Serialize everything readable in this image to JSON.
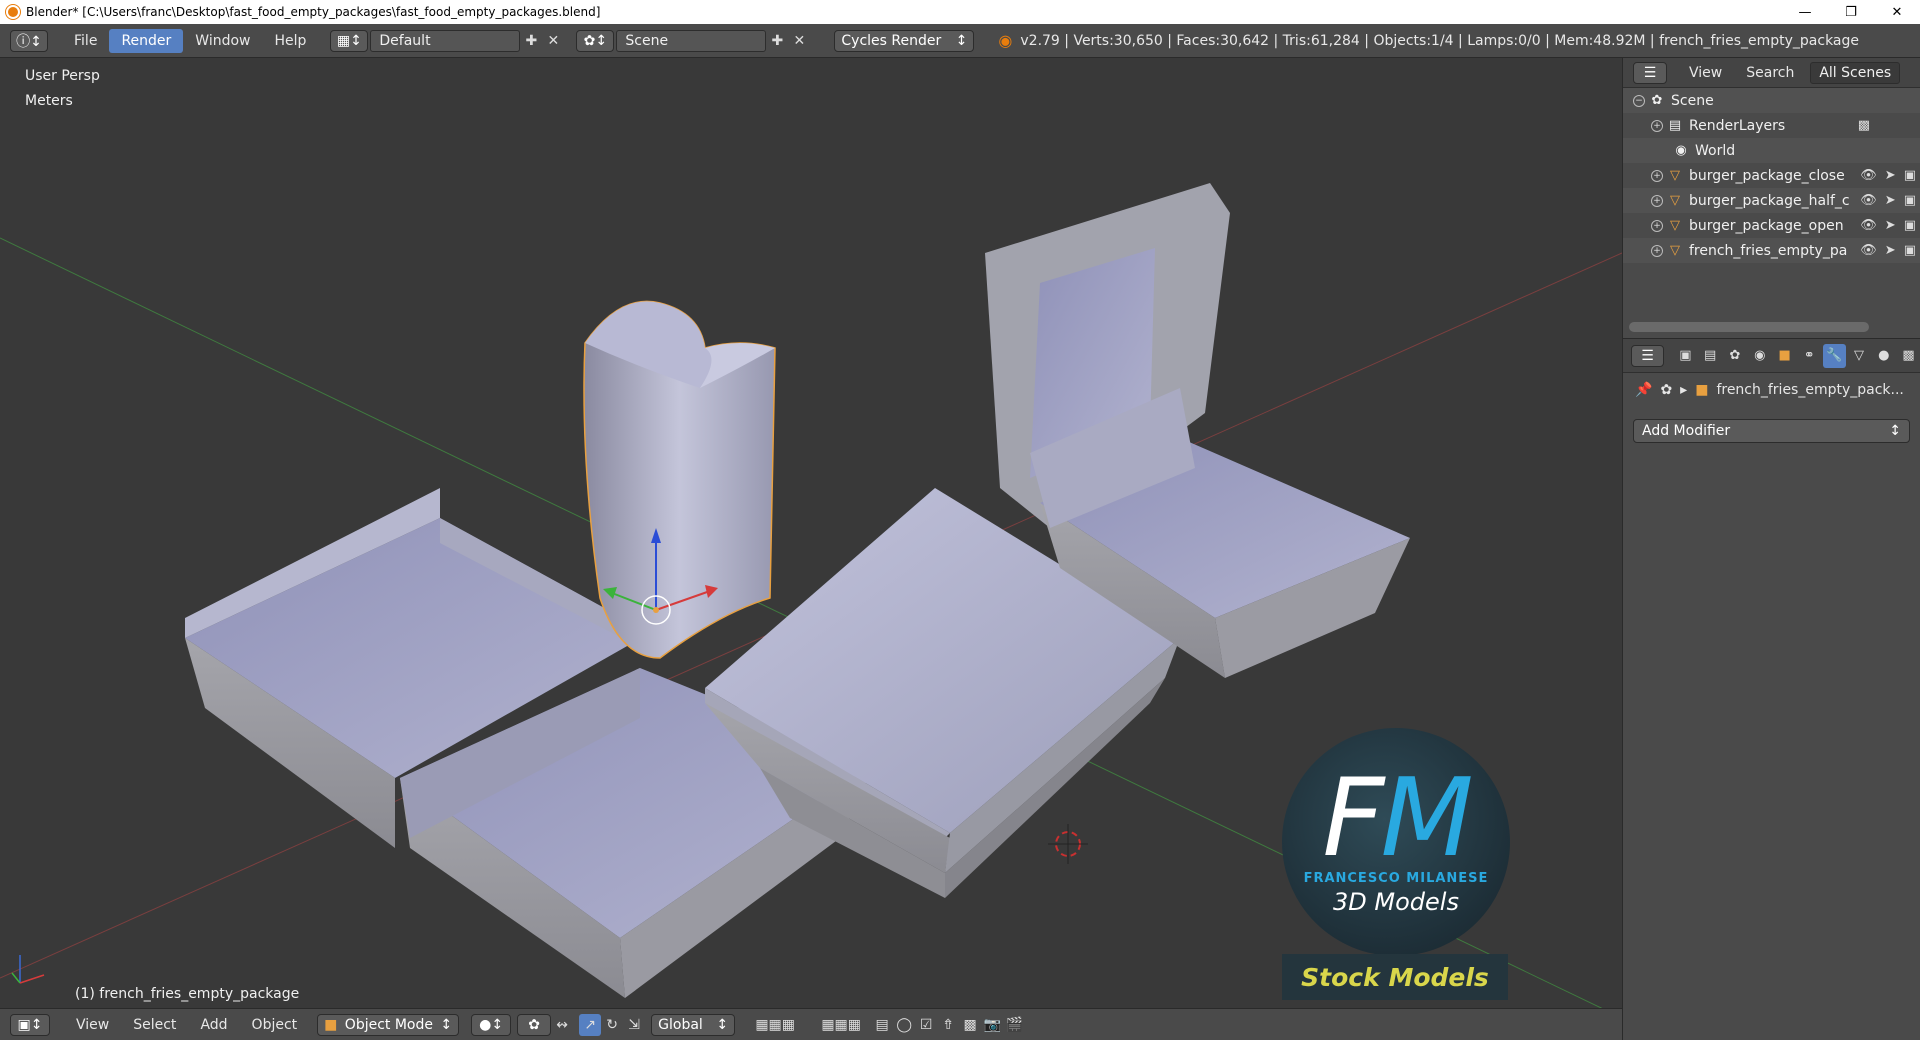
{
  "window": {
    "title": "Blender* [C:\\Users\\franc\\Desktop\\fast_food_empty_packages\\fast_food_empty_packages.blend]",
    "minimize_icon": "minimize-icon",
    "maximize_icon": "restore-icon",
    "close_icon": "close-icon"
  },
  "topbar": {
    "menus": [
      "File",
      "Render",
      "Window",
      "Help"
    ],
    "active_menu": "Render",
    "layout": "Default",
    "scene": "Scene",
    "engine": "Cycles Render",
    "info": "v2.79 | Verts:30,650 | Faces:30,642 | Tris:61,284 | Objects:1/4 | Lamps:0/0 | Mem:48.92M | french_fries_empty_package"
  },
  "viewport": {
    "view_name": "User Persp",
    "units": "Meters",
    "active_object": "(1) french_fries_empty_package"
  },
  "bottombar": {
    "menus": [
      "View",
      "Select",
      "Add",
      "Object"
    ],
    "mode": "Object Mode",
    "orientation": "Global"
  },
  "outliner": {
    "menus": [
      "View",
      "Search"
    ],
    "filter": "All Scenes",
    "rows": [
      {
        "label": "Scene",
        "icon": "scene-icon"
      },
      {
        "label": "RenderLayers",
        "icon": "render-layers-icon"
      },
      {
        "label": "World",
        "icon": "world-icon"
      },
      {
        "label": "burger_package_close",
        "icon": "mesh-icon"
      },
      {
        "label": "burger_package_half_c",
        "icon": "mesh-icon"
      },
      {
        "label": "burger_package_open",
        "icon": "mesh-icon"
      },
      {
        "label": "french_fries_empty_pa",
        "icon": "mesh-icon"
      }
    ]
  },
  "properties": {
    "object_name": "french_fries_empty_pack...",
    "add_modifier": "Add Modifier"
  },
  "watermark": {
    "f": "F",
    "m": "M",
    "name": "FRANCESCO MILANESE",
    "subtitle": "3D Models",
    "banner": "Stock Models"
  }
}
